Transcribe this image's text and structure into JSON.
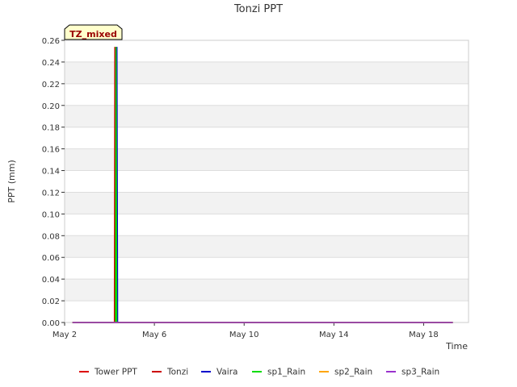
{
  "chart_data": {
    "type": "line",
    "title": "Tonzi PPT",
    "xlabel": "Time",
    "ylabel": "PPT (mm)",
    "annotation": "TZ_mixed",
    "x_ticks": [
      {
        "value": 2,
        "label": "May 2"
      },
      {
        "value": 6,
        "label": "May 6"
      },
      {
        "value": 10,
        "label": "May 10"
      },
      {
        "value": 14,
        "label": "May 14"
      },
      {
        "value": 18,
        "label": "May 18"
      }
    ],
    "xlim": [
      2,
      20
    ],
    "ylim": [
      0,
      0.26
    ],
    "y_ticks": [
      {
        "value": 0.0,
        "label": "0.00"
      },
      {
        "value": 0.02,
        "label": "0.02"
      },
      {
        "value": 0.04,
        "label": "0.04"
      },
      {
        "value": 0.06,
        "label": "0.06"
      },
      {
        "value": 0.08,
        "label": "0.08"
      },
      {
        "value": 0.1,
        "label": "0.10"
      },
      {
        "value": 0.12,
        "label": "0.12"
      },
      {
        "value": 0.14,
        "label": "0.14"
      },
      {
        "value": 0.16,
        "label": "0.16"
      },
      {
        "value": 0.18,
        "label": "0.18"
      },
      {
        "value": 0.2,
        "label": "0.20"
      },
      {
        "value": 0.22,
        "label": "0.22"
      },
      {
        "value": 0.24,
        "label": "0.24"
      },
      {
        "value": 0.26,
        "label": "0.26"
      }
    ],
    "grid": true,
    "legend_position": "bottom",
    "series": [
      {
        "name": "Tower PPT",
        "color": "#dd0000",
        "points": [
          [
            2.35,
            0
          ],
          [
            19.3,
            0
          ]
        ]
      },
      {
        "name": "Tonzi",
        "color": "#cc0000",
        "points": [
          [
            2.35,
            0
          ],
          [
            4.22,
            0
          ],
          [
            4.24,
            0.254
          ],
          [
            4.27,
            0
          ],
          [
            19.3,
            0
          ]
        ]
      },
      {
        "name": "Vaira",
        "color": "#0000cc",
        "points": [
          [
            2.35,
            0
          ],
          [
            4.31,
            0
          ],
          [
            4.33,
            0.254
          ],
          [
            4.36,
            0
          ],
          [
            19.3,
            0
          ]
        ]
      },
      {
        "name": "sp1_Rain",
        "color": "#00dd00",
        "points": [
          [
            2.35,
            0
          ],
          [
            4.27,
            0
          ],
          [
            4.29,
            0.254
          ],
          [
            4.32,
            0
          ],
          [
            19.3,
            0
          ]
        ]
      },
      {
        "name": "sp2_Rain",
        "color": "#ffa500",
        "points": [
          [
            2.35,
            0
          ],
          [
            19.3,
            0
          ]
        ]
      },
      {
        "name": "sp3_Rain",
        "color": "#9a32cd",
        "points": [
          [
            2.35,
            0
          ],
          [
            19.3,
            0
          ]
        ]
      }
    ]
  }
}
